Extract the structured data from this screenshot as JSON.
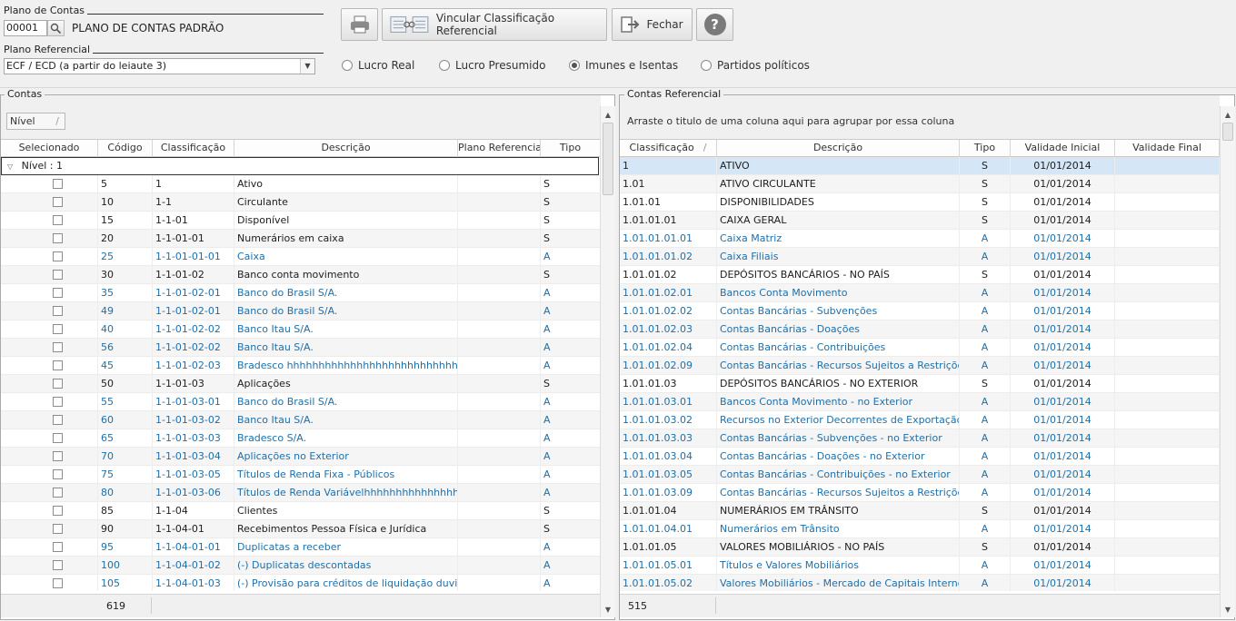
{
  "plano_contas": {
    "label": "Plano de Contas",
    "code": "00001",
    "name": "PLANO DE CONTAS PADRÃO"
  },
  "plano_referencial": {
    "label": "Plano Referencial",
    "selected": "ECF / ECD (a partir do leiaute 3)"
  },
  "toolbar": {
    "vincular_label": "Vincular Classificação Referencial",
    "fechar_label": "Fechar",
    "help_label": "?"
  },
  "radios": [
    {
      "label": "Lucro Real",
      "checked": false
    },
    {
      "label": "Lucro Presumido",
      "checked": false
    },
    {
      "label": "Imunes e Isentas",
      "checked": true
    },
    {
      "label": "Partidos políticos",
      "checked": false
    }
  ],
  "contas": {
    "title": "Contas",
    "group_chip": "Nível",
    "columns": [
      "Selecionado",
      "Código",
      "Classificação",
      "Descrição",
      "Plano Referencia",
      "Tipo"
    ],
    "group_row": "Nível : 1",
    "rows": [
      {
        "codigo": "5",
        "class": "1",
        "desc": "Ativo",
        "tipo": "S"
      },
      {
        "codigo": "10",
        "class": "1-1",
        "desc": "Circulante",
        "tipo": "S"
      },
      {
        "codigo": "15",
        "class": "1-1-01",
        "desc": "Disponível",
        "tipo": "S"
      },
      {
        "codigo": "20",
        "class": "1-1-01-01",
        "desc": "Numerários em caixa",
        "tipo": "S"
      },
      {
        "codigo": "25",
        "class": "1-1-01-01-01",
        "desc": "Caixa",
        "tipo": "A"
      },
      {
        "codigo": "30",
        "class": "1-1-01-02",
        "desc": "Banco conta movimento",
        "tipo": "S"
      },
      {
        "codigo": "35",
        "class": "1-1-01-02-01",
        "desc": "Banco do Brasil S/A.",
        "tipo": "A"
      },
      {
        "codigo": "49",
        "class": "1-1-01-02-01",
        "desc": "Banco do Brasil S/A.",
        "tipo": "A"
      },
      {
        "codigo": "40",
        "class": "1-1-01-02-02",
        "desc": "Banco Itau S/A.",
        "tipo": "A"
      },
      {
        "codigo": "56",
        "class": "1-1-01-02-02",
        "desc": "Banco Itau S/A.",
        "tipo": "A"
      },
      {
        "codigo": "45",
        "class": "1-1-01-02-03",
        "desc": "Bradesco hhhhhhhhhhhhhhhhhhhhhhhhhhhhhhhh",
        "tipo": "A"
      },
      {
        "codigo": "50",
        "class": "1-1-01-03",
        "desc": "Aplicações",
        "tipo": "S"
      },
      {
        "codigo": "55",
        "class": "1-1-01-03-01",
        "desc": "Banco do Brasil S/A.",
        "tipo": "A"
      },
      {
        "codigo": "60",
        "class": "1-1-01-03-02",
        "desc": "Banco Itau S/A.",
        "tipo": "A"
      },
      {
        "codigo": "65",
        "class": "1-1-01-03-03",
        "desc": "Bradesco S/A.",
        "tipo": "A"
      },
      {
        "codigo": "70",
        "class": "1-1-01-03-04",
        "desc": "Aplicações no Exterior",
        "tipo": "A"
      },
      {
        "codigo": "75",
        "class": "1-1-01-03-05",
        "desc": "Títulos de Renda Fixa - Públicos",
        "tipo": "A"
      },
      {
        "codigo": "80",
        "class": "1-1-01-03-06",
        "desc": "Títulos de Renda Variávelhhhhhhhhhhhhhhhhhhhh",
        "tipo": "A"
      },
      {
        "codigo": "85",
        "class": "1-1-04",
        "desc": "Clientes",
        "tipo": "S"
      },
      {
        "codigo": "90",
        "class": "1-1-04-01",
        "desc": "Recebimentos Pessoa Física e Jurídica",
        "tipo": "S"
      },
      {
        "codigo": "95",
        "class": "1-1-04-01-01",
        "desc": "Duplicatas a receber",
        "tipo": "A"
      },
      {
        "codigo": "100",
        "class": "1-1-04-01-02",
        "desc": "(-) Duplicatas descontadas",
        "tipo": "A"
      },
      {
        "codigo": "105",
        "class": "1-1-04-01-03",
        "desc": "(-) Provisão para créditos de liquidação duvidosa",
        "tipo": "A"
      }
    ],
    "count": "619"
  },
  "referencial": {
    "title": "Contas Referencial",
    "group_hint": "Arraste o titulo de uma coluna aqui para agrupar por essa coluna",
    "columns": [
      "Classificação",
      "Descrição",
      "Tipo",
      "Validade Inicial",
      "Validade Final"
    ],
    "rows": [
      {
        "class": "1",
        "desc": "ATIVO",
        "tipo": "S",
        "vi": "01/01/2014",
        "vf": ""
      },
      {
        "class": "1.01",
        "desc": "ATIVO CIRCULANTE",
        "tipo": "S",
        "vi": "01/01/2014",
        "vf": ""
      },
      {
        "class": "1.01.01",
        "desc": "DISPONIBILIDADES",
        "tipo": "S",
        "vi": "01/01/2014",
        "vf": ""
      },
      {
        "class": "1.01.01.01",
        "desc": "CAIXA GERAL",
        "tipo": "S",
        "vi": "01/01/2014",
        "vf": ""
      },
      {
        "class": "1.01.01.01.01",
        "desc": "Caixa Matriz",
        "tipo": "A",
        "vi": "01/01/2014",
        "vf": ""
      },
      {
        "class": "1.01.01.01.02",
        "desc": "Caixa Filiais",
        "tipo": "A",
        "vi": "01/01/2014",
        "vf": ""
      },
      {
        "class": "1.01.01.02",
        "desc": "DEPÓSITOS BANCÁRIOS - NO PAÍS",
        "tipo": "S",
        "vi": "01/01/2014",
        "vf": ""
      },
      {
        "class": "1.01.01.02.01",
        "desc": "Bancos Conta Movimento",
        "tipo": "A",
        "vi": "01/01/2014",
        "vf": ""
      },
      {
        "class": "1.01.01.02.02",
        "desc": "Contas Bancárias - Subvenções",
        "tipo": "A",
        "vi": "01/01/2014",
        "vf": ""
      },
      {
        "class": "1.01.01.02.03",
        "desc": "Contas Bancárias - Doações",
        "tipo": "A",
        "vi": "01/01/2014",
        "vf": ""
      },
      {
        "class": "1.01.01.02.04",
        "desc": "Contas Bancárias - Contribuições",
        "tipo": "A",
        "vi": "01/01/2014",
        "vf": ""
      },
      {
        "class": "1.01.01.02.09",
        "desc": "Contas Bancárias - Recursos Sujeitos a Restrições",
        "tipo": "A",
        "vi": "01/01/2014",
        "vf": ""
      },
      {
        "class": "1.01.01.03",
        "desc": "DEPÓSITOS BANCÁRIOS - NO EXTERIOR",
        "tipo": "S",
        "vi": "01/01/2014",
        "vf": ""
      },
      {
        "class": "1.01.01.03.01",
        "desc": "Bancos Conta Movimento - no Exterior",
        "tipo": "A",
        "vi": "01/01/2014",
        "vf": ""
      },
      {
        "class": "1.01.01.03.02",
        "desc": "Recursos no Exterior Decorrentes de Exportação",
        "tipo": "A",
        "vi": "01/01/2014",
        "vf": ""
      },
      {
        "class": "1.01.01.03.03",
        "desc": "Contas Bancárias - Subvenções - no Exterior",
        "tipo": "A",
        "vi": "01/01/2014",
        "vf": ""
      },
      {
        "class": "1.01.01.03.04",
        "desc": "Contas Bancárias - Doações - no Exterior",
        "tipo": "A",
        "vi": "01/01/2014",
        "vf": ""
      },
      {
        "class": "1.01.01.03.05",
        "desc": "Contas Bancárias - Contribuições - no Exterior",
        "tipo": "A",
        "vi": "01/01/2014",
        "vf": ""
      },
      {
        "class": "1.01.01.03.09",
        "desc": "Contas Bancárias - Recursos Sujeitos a Restrições - no Exterior",
        "tipo": "A",
        "vi": "01/01/2014",
        "vf": ""
      },
      {
        "class": "1.01.01.04",
        "desc": "NUMERÁRIOS EM TRÂNSITO",
        "tipo": "S",
        "vi": "01/01/2014",
        "vf": ""
      },
      {
        "class": "1.01.01.04.01",
        "desc": "Numerários em Trânsito",
        "tipo": "A",
        "vi": "01/01/2014",
        "vf": ""
      },
      {
        "class": "1.01.01.05",
        "desc": "VALORES MOBILIÁRIOS - NO PAÍS",
        "tipo": "S",
        "vi": "01/01/2014",
        "vf": ""
      },
      {
        "class": "1.01.01.05.01",
        "desc": "Títulos e Valores Mobiliários",
        "tipo": "A",
        "vi": "01/01/2014",
        "vf": ""
      },
      {
        "class": "1.01.01.05.02",
        "desc": "Valores Mobiliários - Mercado de Capitais Interno",
        "tipo": "A",
        "vi": "01/01/2014",
        "vf": ""
      }
    ],
    "count": "515"
  },
  "colors": {
    "analytic_text": "#1f6fa8",
    "selected_row": "#d5e6f6"
  }
}
